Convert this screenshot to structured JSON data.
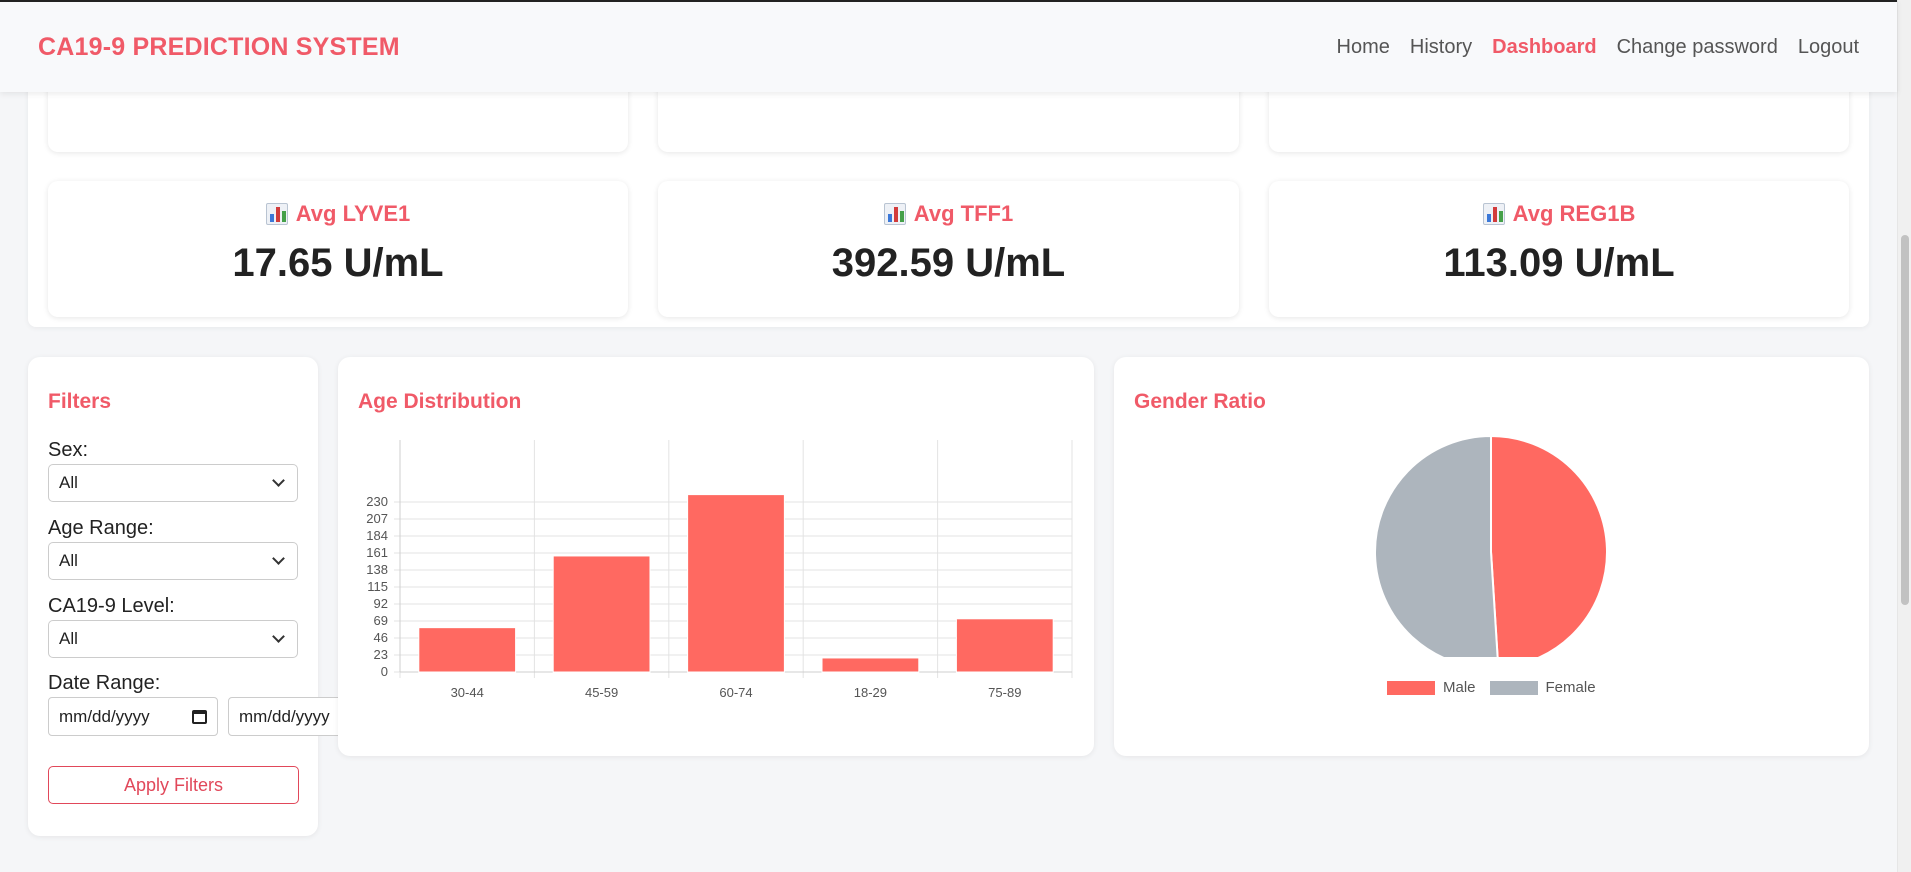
{
  "nav": {
    "brand": "CA19-9 PREDICTION SYSTEM",
    "links": [
      "Home",
      "History",
      "Dashboard",
      "Change password",
      "Logout"
    ],
    "active": "Dashboard"
  },
  "stats": [
    {
      "label": "Avg LYVE1",
      "value": "17.65 U/mL"
    },
    {
      "label": "Avg TFF1",
      "value": "392.59 U/mL"
    },
    {
      "label": "Avg REG1B",
      "value": "113.09 U/mL"
    }
  ],
  "filters": {
    "title": "Filters",
    "sex_label": "Sex:",
    "sex_value": "All",
    "age_label": "Age Range:",
    "age_value": "All",
    "ca_label": "CA19-9 Level:",
    "ca_value": "All",
    "date_label": "Date Range:",
    "date_from_placeholder": "mm/dd/yyyy",
    "date_to_placeholder": "mm/dd/yyyy",
    "apply_label": "Apply Filters"
  },
  "colors": {
    "accent": "#f05a68",
    "bar": "#ff6961",
    "male": "#ff6961",
    "female": "#adb5bd"
  },
  "charts": {
    "age_title": "Age Distribution",
    "gender_title": "Gender Ratio"
  },
  "chart_data": [
    {
      "type": "bar",
      "title": "Age Distribution",
      "categories": [
        "30-44",
        "45-59",
        "60-74",
        "18-29",
        "75-89"
      ],
      "values": [
        60,
        157,
        240,
        19,
        72
      ],
      "yticks": [
        0,
        23,
        46,
        69,
        92,
        115,
        138,
        161,
        184,
        207,
        230
      ],
      "ylim": [
        0,
        240
      ],
      "grid": true
    },
    {
      "type": "pie",
      "title": "Gender Ratio",
      "labels": [
        "Male",
        "Female"
      ],
      "values": [
        49,
        51
      ],
      "legend": "bottom"
    }
  ]
}
